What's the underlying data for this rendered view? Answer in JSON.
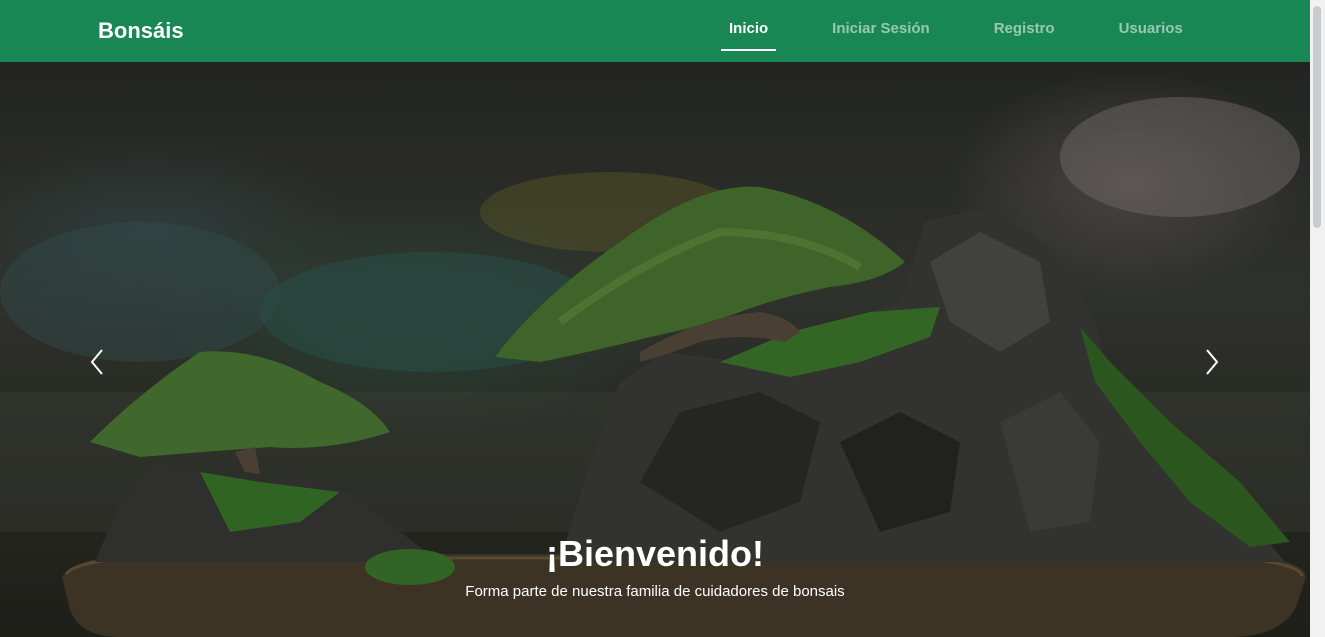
{
  "navbar": {
    "brand": "Bonsáis",
    "links": [
      {
        "label": "Inicio",
        "active": true
      },
      {
        "label": "Iniciar Sesión",
        "active": false
      },
      {
        "label": "Registro",
        "active": false
      },
      {
        "label": "Usuarios",
        "active": false
      }
    ]
  },
  "carousel": {
    "title": "¡Bienvenido!",
    "text": "Forma parte de nuestra familia de cuidadores de bonsais",
    "prev_icon": "chevron-left-icon",
    "next_icon": "chevron-right-icon"
  },
  "colors": {
    "navbar_bg": "#198754",
    "nav_active": "#ffffff",
    "nav_inactive": "rgba(255,255,255,0.55)"
  }
}
